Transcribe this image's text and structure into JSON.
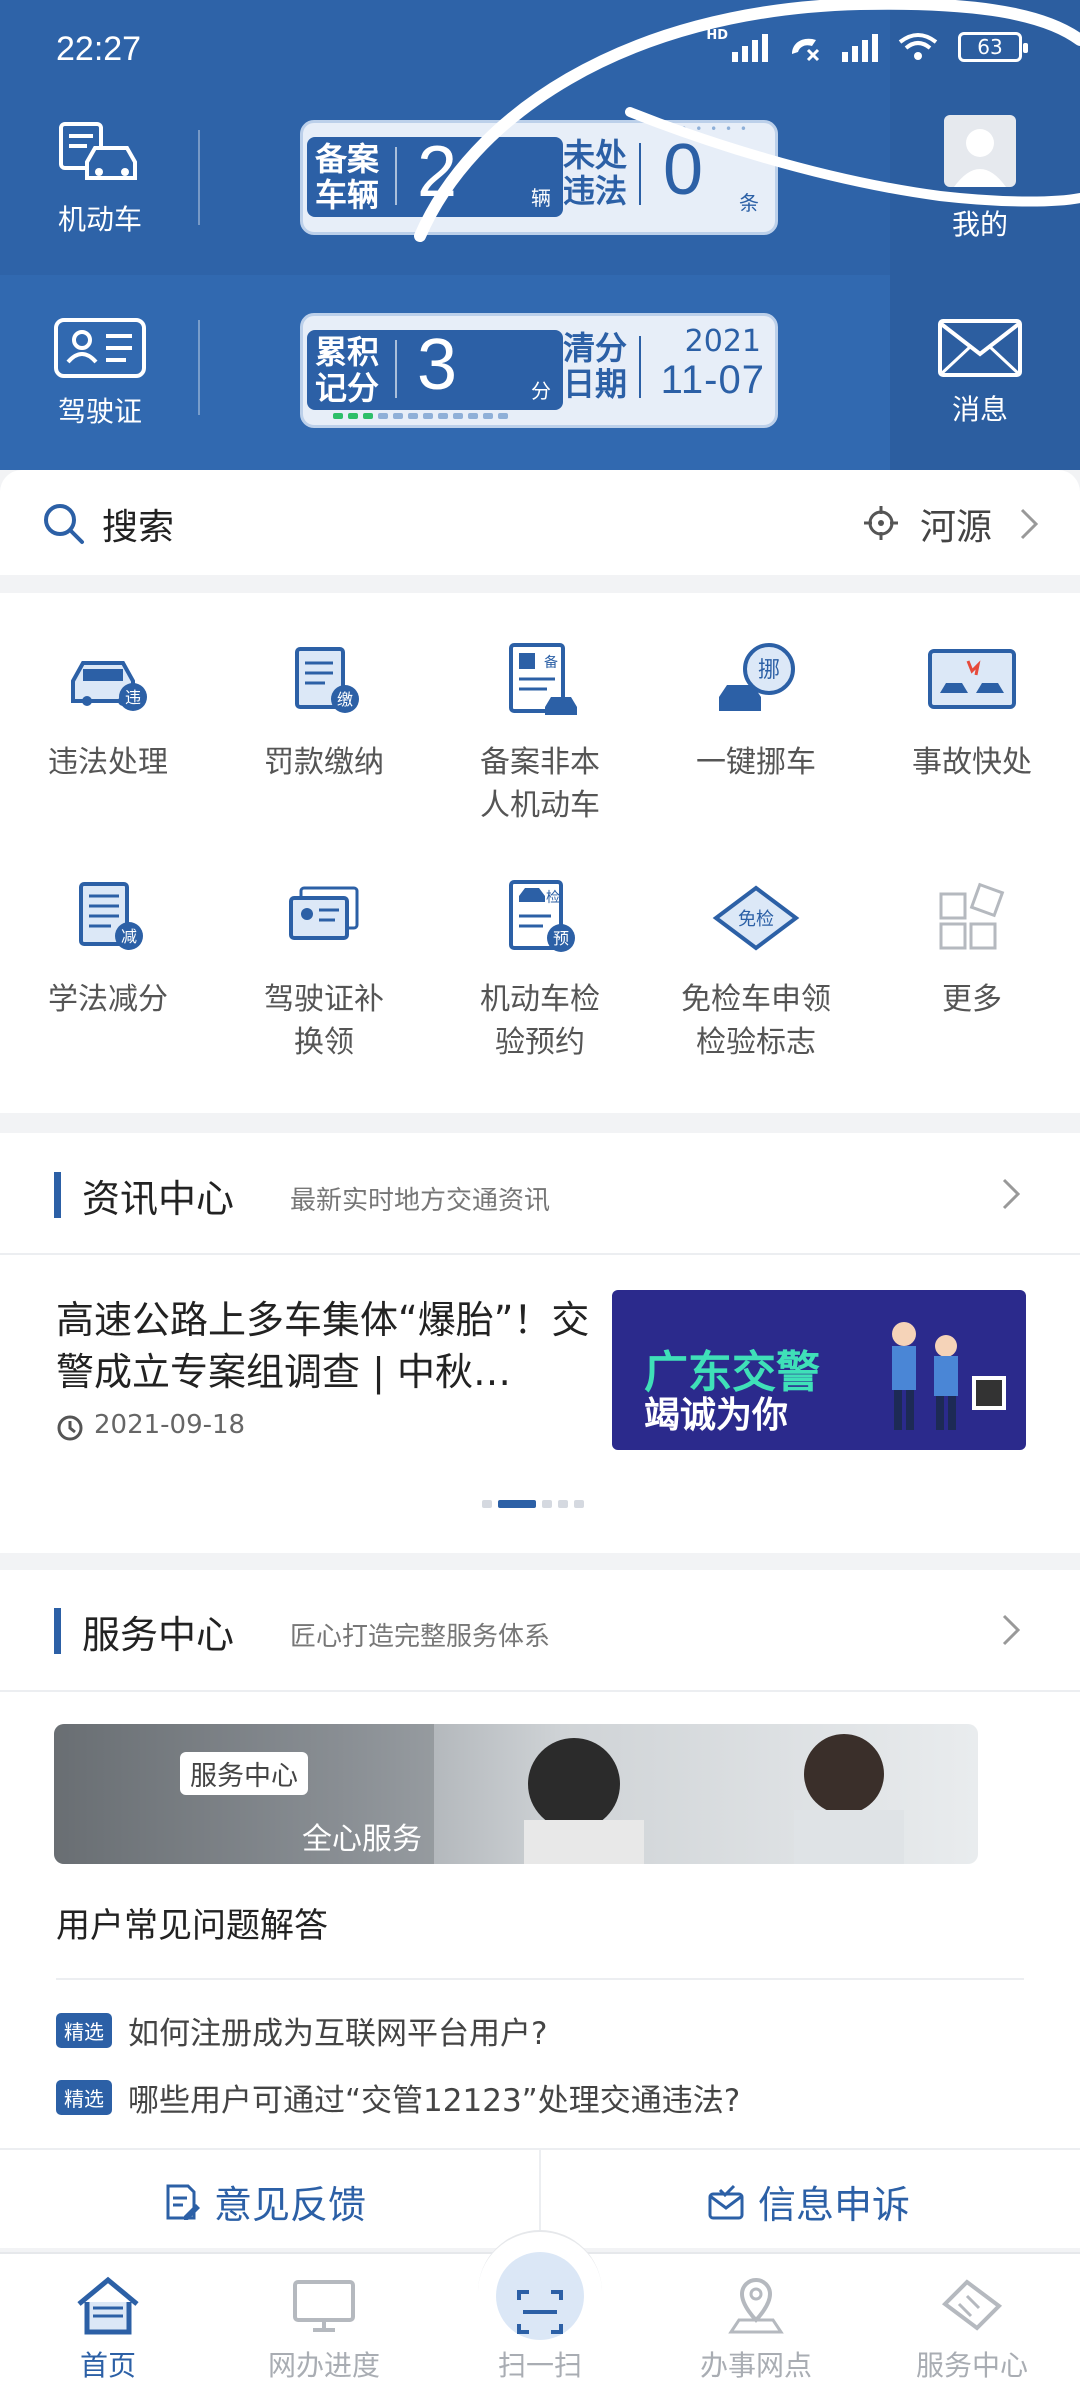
{
  "status": {
    "time": "22:27",
    "battery": "63",
    "hd": "HD"
  },
  "header": {
    "vehicle_label": "机动车",
    "license_label": "驾驶证",
    "me_label": "我的",
    "message_label": "消息",
    "plate1": {
      "left_label": "备案车辆",
      "left_value": "2",
      "left_unit": "辆",
      "right_label": "未处违法",
      "right_value": "0",
      "right_unit": "条"
    },
    "plate2": {
      "left_label": "累积记分",
      "left_value": "3",
      "left_unit": "分",
      "right_label": "清分日期",
      "year": "2021",
      "date": "11-07"
    }
  },
  "search": {
    "placeholder": "搜索",
    "city": "河源"
  },
  "services": [
    {
      "label": "违法处理",
      "icon": "car-violation-icon"
    },
    {
      "label": "罚款缴纳",
      "icon": "fine-payment-icon"
    },
    {
      "label": "备案非本\n人机动车",
      "icon": "register-vehicle-icon"
    },
    {
      "label": "一键挪车",
      "icon": "move-car-icon"
    },
    {
      "label": "事故快处",
      "icon": "accident-icon"
    },
    {
      "label": "学法减分",
      "icon": "study-reduce-icon"
    },
    {
      "label": "驾驶证补\n换领",
      "icon": "license-renew-icon"
    },
    {
      "label": "机动车检\n验预约",
      "icon": "inspection-booking-icon"
    },
    {
      "label": "免检车申领\n检验标志",
      "icon": "exempt-inspection-icon"
    },
    {
      "label": "更多",
      "icon": "more-icon"
    }
  ],
  "news": {
    "title": "资讯中心",
    "subtitle": "最新实时地方交通资讯",
    "headline": "高速公路上多车集体“爆胎”！交警成立专案组调查 | 中秋…",
    "date": "2021-09-18",
    "banner_title": "广东交警",
    "banner_sub": "竭诚为你"
  },
  "service_center": {
    "title": "服务中心",
    "subtitle": "匠心打造完整服务体系",
    "banner_tag": "服务中心",
    "banner_line": "全心服务",
    "faq_title": "用户常见问题解答",
    "badge": "精选",
    "faq": [
      "如何注册成为互联网平台用户?",
      "哪些用户可通过“交管12123”处理交通违法?"
    ]
  },
  "feedback": {
    "left": "意见反馈",
    "right": "信息申诉"
  },
  "nav": [
    "首页",
    "网办进度",
    "扫一扫",
    "办事网点",
    "服务中心"
  ],
  "colors": {
    "brand": "#2c60a6",
    "header": "#2e63a8"
  }
}
